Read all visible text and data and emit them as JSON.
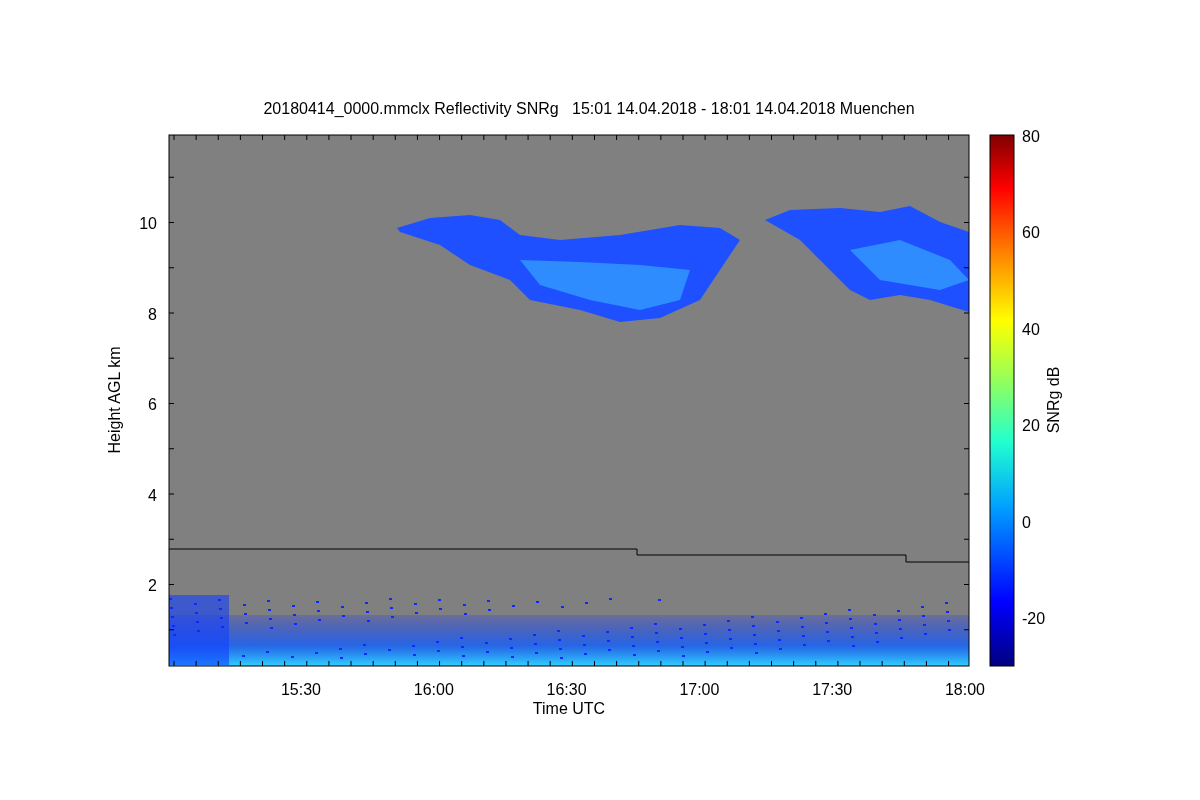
{
  "title": "20180414_0000.mmclx Reflectivity SNRg   15:01 14.04.2018 - 18:01 14.04.2018 Muenchen",
  "plot": {
    "ylabel": "Height AGL km",
    "xlabel": "Time UTC",
    "yticks": [
      "10",
      "8",
      "6",
      "4",
      "2"
    ],
    "xticks": [
      "15:30",
      "16:00",
      "16:30",
      "17:00",
      "17:30",
      "18:00"
    ]
  },
  "colorbar": {
    "label": "SNRg dB",
    "ticks": [
      "80",
      "60",
      "40",
      "20",
      "0",
      "-20"
    ]
  }
}
